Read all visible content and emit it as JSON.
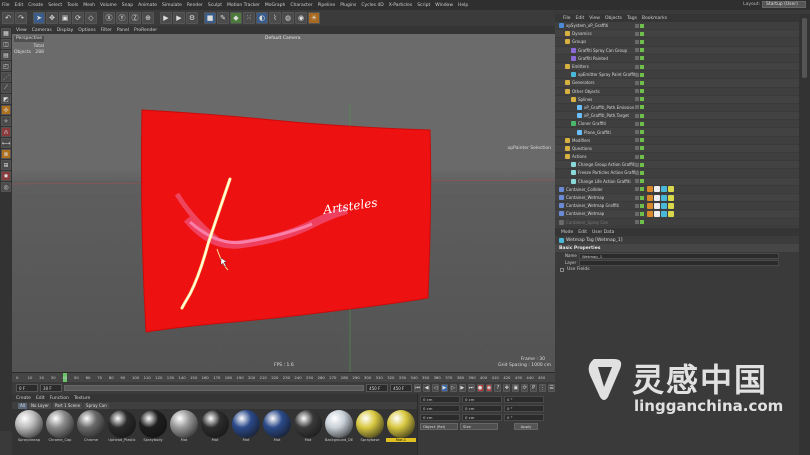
{
  "menubar": {
    "items": [
      "File",
      "Edit",
      "Create",
      "Select",
      "Tools",
      "Mesh",
      "Volume",
      "Snap",
      "Animate",
      "Simulate",
      "Render",
      "Sculpt",
      "Motion Tracker",
      "MoGraph",
      "Character",
      "Pipeline",
      "Plugins",
      "Cycles 4D",
      "X-Particles",
      "Script",
      "Window",
      "Help"
    ],
    "layout_label": "Layout:",
    "layout_value": "Startup (User)"
  },
  "viewport": {
    "menu": [
      "View",
      "Cameras",
      "Display",
      "Options",
      "Filter",
      "Panel",
      "ProRender"
    ],
    "camera_label": "Default Camera",
    "view_title": "Perspective",
    "stats": [
      {
        "label": "Total",
        "value": ""
      },
      {
        "label": "Objects",
        "value": "288"
      }
    ],
    "overlay_label": "xpPainter Selection",
    "fps": "FPS : 1.6",
    "grid_spacing": "Grid Spacing : 1000 cm",
    "frame": "Frame : 30",
    "graffiti_text": "Artsteles"
  },
  "timeline": {
    "ticks": [
      "0",
      "10",
      "20",
      "30",
      "40",
      "50",
      "60",
      "70",
      "80",
      "90",
      "100",
      "110",
      "120",
      "130",
      "140",
      "150",
      "160",
      "170",
      "180",
      "190",
      "200",
      "210",
      "220",
      "230",
      "240",
      "250",
      "260",
      "270",
      "280",
      "290",
      "300",
      "310",
      "320",
      "330",
      "340",
      "350",
      "360",
      "370",
      "380",
      "390",
      "400",
      "410",
      "420",
      "430",
      "440",
      "450"
    ],
    "start_field": "0 F",
    "current_field": "30 F",
    "end_field": "450 F",
    "max_field": "450 F"
  },
  "materials": {
    "menu": [
      "Create",
      "Edit",
      "Function",
      "Texture"
    ],
    "filters": [
      "All",
      "No Layer",
      "Part 1 Scene",
      "Spray Can"
    ],
    "items": [
      {
        "name": "Spraycleanp",
        "color": "#bcbcbc"
      },
      {
        "name": "Chrome_Cap",
        "color": "#8a8a8a"
      },
      {
        "name": "Chrome",
        "color": "#6a6a6a"
      },
      {
        "name": "Uphead_Plastic",
        "color": "#2a2a2a"
      },
      {
        "name": "Spraybody",
        "color": "#1e1e1e"
      },
      {
        "name": "Mat",
        "color": "#999999"
      },
      {
        "name": "Mat",
        "color": "#2c2c2c"
      },
      {
        "name": "Mat",
        "color": "#2b4a8a"
      },
      {
        "name": "Mat",
        "color": "#2b4a8a"
      },
      {
        "name": "Mat",
        "color": "#3a3a3a"
      },
      {
        "name": "Background_DE",
        "color": "#c8d0d8"
      },
      {
        "name": "Spraybase",
        "color": "#d8c840"
      },
      {
        "name": "Mat.1",
        "color": "#d8c840"
      },
      {
        "name": "Mat",
        "color": "#c8902a"
      }
    ],
    "selected_index": 12
  },
  "coords": {
    "rows": [
      {
        "a": "0 cm",
        "b": "0 cm",
        "c": "0 °"
      },
      {
        "a": "0 cm",
        "b": "0 cm",
        "c": "0 °"
      },
      {
        "a": "0 cm",
        "b": "0 cm",
        "c": "0 °"
      }
    ],
    "mode": "Object (Rel)",
    "size_mode": "Size",
    "apply_label": "Apply"
  },
  "objects": {
    "menu": [
      "File",
      "Edit",
      "View",
      "Objects",
      "Tags",
      "Bookmarks"
    ],
    "rows": [
      {
        "name": "xpSystem_xP_Graffiti",
        "indent": 0,
        "color": "#4a8ad8"
      },
      {
        "name": "Dynamics",
        "indent": 1,
        "color": "#d8b040"
      },
      {
        "name": "Groups",
        "indent": 1,
        "color": "#d8b040"
      },
      {
        "name": "Graffiti Spray Can Group",
        "indent": 2,
        "color": "#8a6ad8"
      },
      {
        "name": "Graffiti Painted",
        "indent": 2,
        "color": "#8a6ad8"
      },
      {
        "name": "Emitters",
        "indent": 1,
        "color": "#d8b040"
      },
      {
        "name": "xpEmitter Spray Paint Graffiti",
        "indent": 2,
        "color": "#4ab8d8"
      },
      {
        "name": "Generators",
        "indent": 1,
        "color": "#d8b040"
      },
      {
        "name": "Other Objects",
        "indent": 1,
        "color": "#d8b040"
      },
      {
        "name": "Splines",
        "indent": 2,
        "color": "#d8b040"
      },
      {
        "name": "xP_Graffiti_Path.Emission",
        "indent": 3,
        "color": "#6ac0ff"
      },
      {
        "name": "xP_Graffiti_Path.Target",
        "indent": 3,
        "color": "#6ac0ff"
      },
      {
        "name": "Cloner Graffiti",
        "indent": 2,
        "color": "#4ab86a"
      },
      {
        "name": "Plane_Graffiti",
        "indent": 3,
        "color": "#6ac0ff"
      },
      {
        "name": "Modifiers",
        "indent": 1,
        "color": "#d8b040"
      },
      {
        "name": "Questions",
        "indent": 1,
        "color": "#d8b040"
      },
      {
        "name": "Actions",
        "indent": 1,
        "color": "#d8b040"
      },
      {
        "name": "Change Group Action Graffiti",
        "indent": 2,
        "color": "#8ad8d8"
      },
      {
        "name": "Freeze Particles Action Graffiti",
        "indent": 2,
        "color": "#8ad8d8"
      },
      {
        "name": "Change Life Action Graffiti",
        "indent": 2,
        "color": "#8ad8d8"
      },
      {
        "name": "Container_Collider",
        "indent": 0,
        "color": "#6a8ad8"
      },
      {
        "name": "Container_Wetmap",
        "indent": 0,
        "color": "#6a8ad8"
      },
      {
        "name": "Container_Wetmap Graffiti",
        "indent": 0,
        "color": "#6a8ad8"
      },
      {
        "name": "Container_Wetmap",
        "indent": 0,
        "color": "#6a8ad8"
      },
      {
        "name": "Container_Spray Can",
        "indent": 0,
        "color": "#6a6a6a",
        "off": true
      }
    ]
  },
  "attributes": {
    "menu": [
      "Mode",
      "Edit",
      "User Data"
    ],
    "title": "Wetmap Tag [Wetmap_1]",
    "tab": "Basic Properties",
    "rows": [
      {
        "label": "Name",
        "value": "Wetmap_1"
      },
      {
        "label": "Layer",
        "value": ""
      }
    ],
    "use_fields_label": "Use Fields"
  },
  "watermark": {
    "cn": "灵感中国",
    "en": "lingganchina.com"
  }
}
